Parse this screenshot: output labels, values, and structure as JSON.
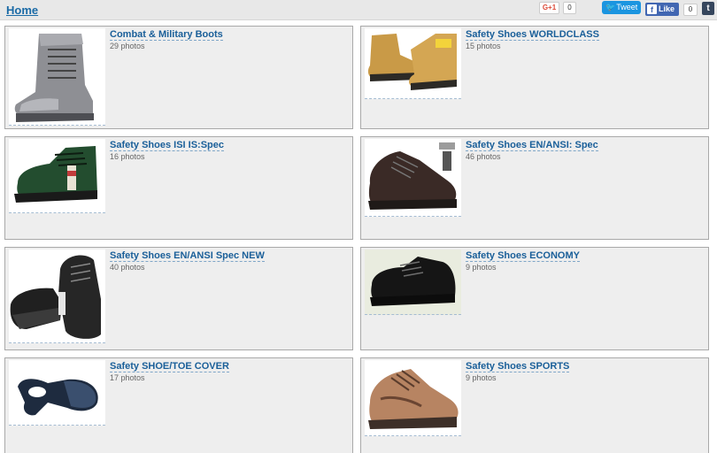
{
  "header": {
    "home_label": "Home",
    "share": {
      "gplus_label": "G+1",
      "gplus_count": "0",
      "tweet_label": "Tweet",
      "fb_label": "Like",
      "fb_count": "0",
      "tumblr_label": "t"
    }
  },
  "categories": [
    {
      "title": "Combat & Military Boots",
      "photos": "29 photos"
    },
    {
      "title": "Safety Shoes WORLDCLASS",
      "photos": "15 photos"
    },
    {
      "title": "Safety Shoes ISI IS:Spec",
      "photos": "16 photos"
    },
    {
      "title": "Safety Shoes EN/ANSI: Spec",
      "photos": "46 photos"
    },
    {
      "title": "Safety Shoes EN/ANSI Spec NEW",
      "photos": "40 photos"
    },
    {
      "title": "Safety Shoes ECONOMY",
      "photos": "9 photos"
    },
    {
      "title": "Safety SHOE/TOE COVER",
      "photos": "17 photos"
    },
    {
      "title": "Safety Shoes SPORTS",
      "photos": "9 photos"
    }
  ],
  "colors": {
    "link": "#1a5f99",
    "card_bg": "#eeeeee",
    "tweet": "#1b95e0",
    "facebook": "#4267b2"
  }
}
